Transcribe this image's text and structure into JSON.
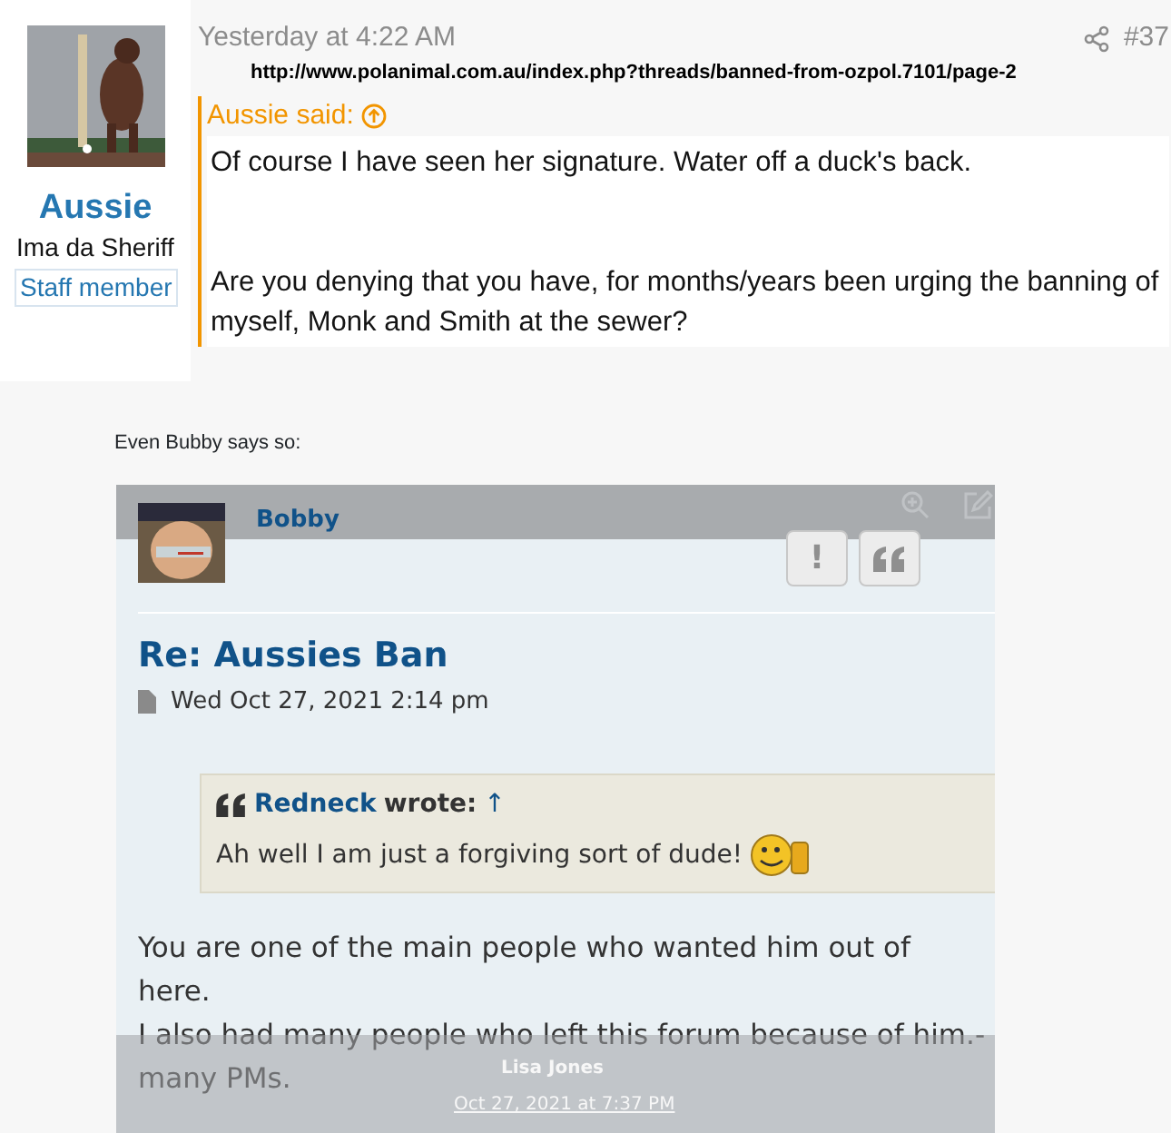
{
  "post": {
    "user": {
      "name": "Aussie",
      "title": "Ima da Sheriff",
      "badge": "Staff member"
    },
    "time": "Yesterday at 4:22 AM",
    "post_number": "#37",
    "url": "http://www.polanimal.com.au/index.php?threads/banned-from-ozpol.7101/page-2",
    "quote": {
      "attribution": "Aussie said:",
      "paragraphs": [
        "Of course I have seen her signature. Water off a duck's back.",
        "Are you denying that you have, for months/years been urging the banning of myself, Monk and Smith at the sewer?"
      ]
    },
    "caption": "Even Bubby says so:"
  },
  "embedded": {
    "author": "Bobby",
    "report_button": "!",
    "title": "Re: Aussies Ban",
    "date": "Wed Oct 27, 2021 2:14 pm",
    "quote": {
      "author": "Redneck",
      "wrote": "wrote:",
      "arrow": "↑",
      "text": "Ah well I am just a forgiving sort of dude!"
    },
    "body_lines": [
      "You are one of the main people who wanted him out of",
      "here.",
      "I also had many people who left this forum because of him.-",
      "many PMs."
    ],
    "footer": {
      "name": "Lisa Jones",
      "date": "Oct 27, 2021 at 7:37 PM"
    }
  }
}
